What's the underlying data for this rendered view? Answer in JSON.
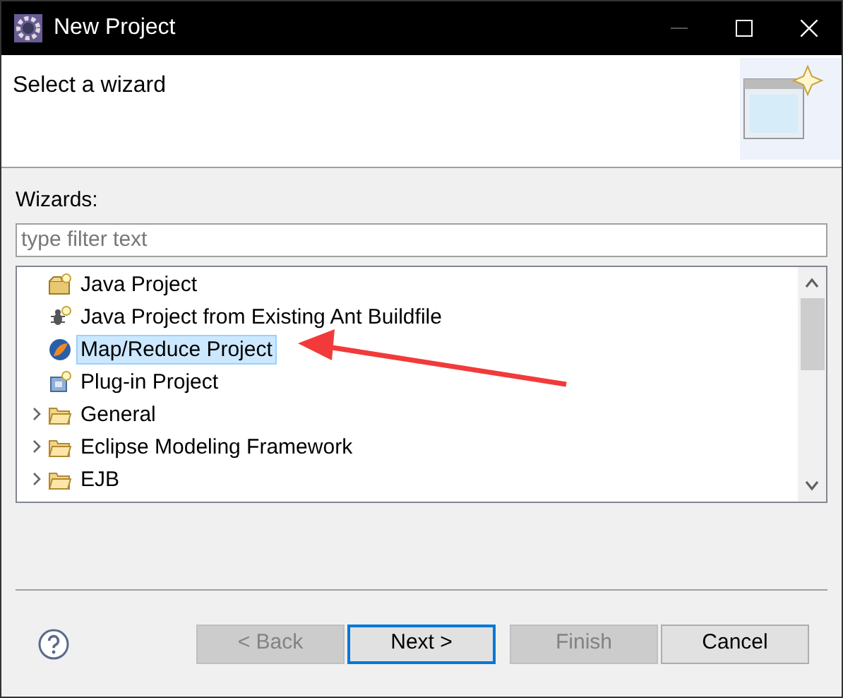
{
  "window": {
    "title": "New Project"
  },
  "header": {
    "title": "Select a wizard"
  },
  "wizards": {
    "label": "Wizards:",
    "filter": {
      "placeholder": "type filter text"
    },
    "tree": [
      {
        "label": "Java Project",
        "kind": "java",
        "selected": false
      },
      {
        "label": "Java Project from Existing Ant Buildfile",
        "kind": "ant",
        "selected": false
      },
      {
        "label": "Map/Reduce Project",
        "kind": "mapreduce",
        "selected": true
      },
      {
        "label": "Plug-in Project",
        "kind": "plugin",
        "selected": false
      },
      {
        "label": "General",
        "kind": "folder",
        "expanded": false,
        "selected": false
      },
      {
        "label": "Eclipse Modeling Framework",
        "kind": "folder",
        "expanded": false,
        "selected": false
      },
      {
        "label": "EJB",
        "kind": "folder",
        "expanded": false,
        "selected": false
      }
    ]
  },
  "buttons": [
    {
      "label": "< Back",
      "disabled": true,
      "default": false
    },
    {
      "label": "Next >",
      "disabled": false,
      "default": true
    },
    {
      "label": "Finish",
      "disabled": true,
      "default": false
    },
    {
      "label": "Cancel",
      "disabled": false,
      "default": false
    }
  ]
}
